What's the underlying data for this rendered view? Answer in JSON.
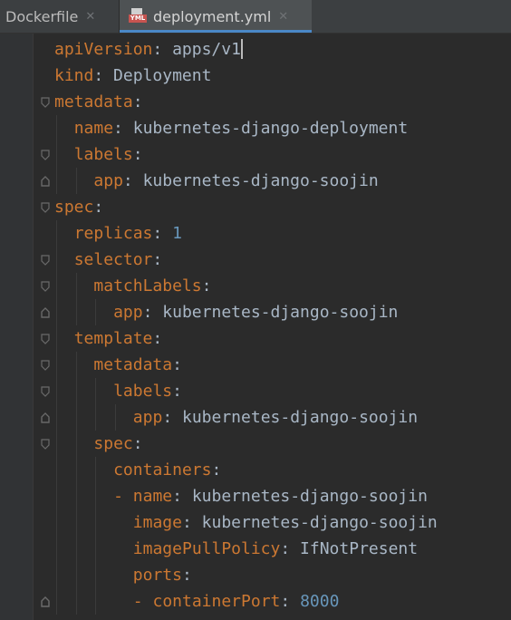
{
  "tabs": [
    {
      "label": "Dockerfile",
      "icon": "docker-file-icon",
      "active": false
    },
    {
      "label": "deployment.yml",
      "icon": "yml-file-icon",
      "icon_text": "YML",
      "active": true
    }
  ],
  "colors": {
    "key": "#cc7832",
    "value": "#a9b7c6",
    "number": "#6897bb",
    "background": "#2b2b2b",
    "active_tab_underline": "#4a88c7"
  },
  "lines": [
    {
      "indent": 0,
      "dash": "",
      "key": "apiVersion",
      "sep": ": ",
      "value": "apps/v1",
      "value_type": "string"
    },
    {
      "indent": 0,
      "dash": "",
      "key": "kind",
      "sep": ": ",
      "value": "Deployment",
      "value_type": "string"
    },
    {
      "indent": 0,
      "dash": "",
      "key": "metadata",
      "sep": ":",
      "value": "",
      "value_type": "string"
    },
    {
      "indent": 1,
      "dash": "",
      "key": "name",
      "sep": ": ",
      "value": "kubernetes-django-deployment",
      "value_type": "string"
    },
    {
      "indent": 1,
      "dash": "",
      "key": "labels",
      "sep": ":",
      "value": "",
      "value_type": "string"
    },
    {
      "indent": 2,
      "dash": "",
      "key": "app",
      "sep": ": ",
      "value": "kubernetes-django-soojin",
      "value_type": "string"
    },
    {
      "indent": 0,
      "dash": "",
      "key": "spec",
      "sep": ":",
      "value": "",
      "value_type": "string"
    },
    {
      "indent": 1,
      "dash": "",
      "key": "replicas",
      "sep": ": ",
      "value": "1",
      "value_type": "number"
    },
    {
      "indent": 1,
      "dash": "",
      "key": "selector",
      "sep": ":",
      "value": "",
      "value_type": "string"
    },
    {
      "indent": 2,
      "dash": "",
      "key": "matchLabels",
      "sep": ":",
      "value": "",
      "value_type": "string"
    },
    {
      "indent": 3,
      "dash": "",
      "key": "app",
      "sep": ": ",
      "value": "kubernetes-django-soojin",
      "value_type": "string"
    },
    {
      "indent": 1,
      "dash": "",
      "key": "template",
      "sep": ":",
      "value": "",
      "value_type": "string"
    },
    {
      "indent": 2,
      "dash": "",
      "key": "metadata",
      "sep": ":",
      "value": "",
      "value_type": "string"
    },
    {
      "indent": 3,
      "dash": "",
      "key": "labels",
      "sep": ":",
      "value": "",
      "value_type": "string"
    },
    {
      "indent": 4,
      "dash": "",
      "key": "app",
      "sep": ": ",
      "value": "kubernetes-django-soojin",
      "value_type": "string"
    },
    {
      "indent": 2,
      "dash": "",
      "key": "spec",
      "sep": ":",
      "value": "",
      "value_type": "string"
    },
    {
      "indent": 3,
      "dash": "",
      "key": "containers",
      "sep": ":",
      "value": "",
      "value_type": "string"
    },
    {
      "indent": 3,
      "dash": "- ",
      "key": "name",
      "sep": ": ",
      "value": "kubernetes-django-soojin",
      "value_type": "string"
    },
    {
      "indent": 4,
      "dash": "",
      "key": "image",
      "sep": ": ",
      "value": "kubernetes-django-soojin",
      "value_type": "string"
    },
    {
      "indent": 4,
      "dash": "",
      "key": "imagePullPolicy",
      "sep": ": ",
      "value": "IfNotPresent",
      "value_type": "string"
    },
    {
      "indent": 4,
      "dash": "",
      "key": "ports",
      "sep": ":",
      "value": "",
      "value_type": "string"
    },
    {
      "indent": 4,
      "dash": "- ",
      "key": "containerPort",
      "sep": ": ",
      "value": "8000",
      "value_type": "number"
    }
  ],
  "caret_line": 1
}
